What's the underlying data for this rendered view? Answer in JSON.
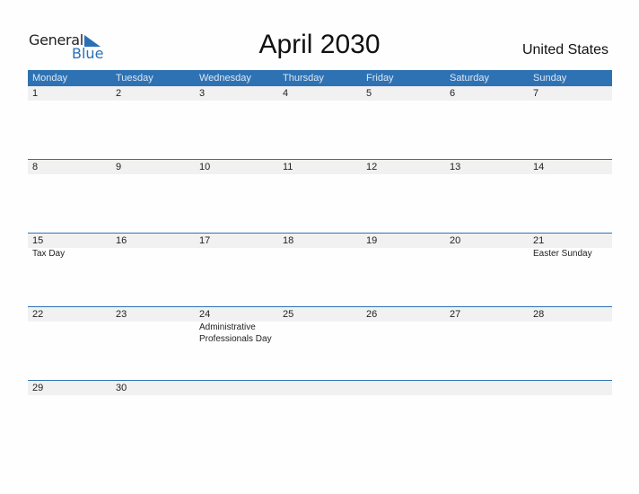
{
  "logo": {
    "line1": "General",
    "line2": "Blue"
  },
  "title": "April 2030",
  "country": "United States",
  "colors": {
    "accent": "#2f72b3",
    "day_band": "#f1f1f1"
  },
  "weekdays": [
    "Monday",
    "Tuesday",
    "Wednesday",
    "Thursday",
    "Friday",
    "Saturday",
    "Sunday"
  ],
  "weeks": [
    {
      "days": [
        "1",
        "2",
        "3",
        "4",
        "5",
        "6",
        "7"
      ],
      "events": [
        "",
        "",
        "",
        "",
        "",
        "",
        ""
      ]
    },
    {
      "days": [
        "8",
        "9",
        "10",
        "11",
        "12",
        "13",
        "14"
      ],
      "events": [
        "",
        "",
        "",
        "",
        "",
        "",
        ""
      ]
    },
    {
      "days": [
        "15",
        "16",
        "17",
        "18",
        "19",
        "20",
        "21"
      ],
      "events": [
        "Tax Day",
        "",
        "",
        "",
        "",
        "",
        "Easter Sunday"
      ]
    },
    {
      "days": [
        "22",
        "23",
        "24",
        "25",
        "26",
        "27",
        "28"
      ],
      "events": [
        "",
        "",
        "Administrative Professionals Day",
        "",
        "",
        "",
        ""
      ]
    },
    {
      "days": [
        "29",
        "30",
        "",
        "",
        "",
        "",
        ""
      ],
      "events": [
        "",
        "",
        "",
        "",
        "",
        "",
        ""
      ]
    }
  ]
}
